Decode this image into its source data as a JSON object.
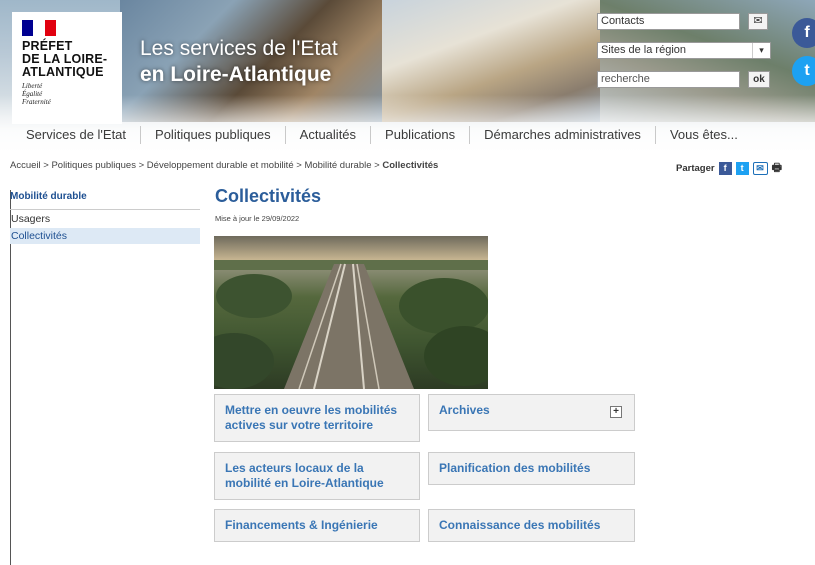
{
  "header": {
    "logo": {
      "title_lines": [
        "PRÉFET",
        "DE LA LOIRE-",
        "ATLANTIQUE"
      ],
      "motto_lines": [
        "Liberté",
        "Égalité",
        "Fraternité"
      ]
    },
    "site_title_line1": "Les services de l'Etat",
    "site_title_line2": "en Loire-Atlantique",
    "contacts_label": "Contacts",
    "sites_select_value": "Sites de la région",
    "search_placeholder": "recherche",
    "ok_label": "ok",
    "mail_icon": "✉",
    "select_caret": "▾",
    "social_fb": "f",
    "social_tw": "t",
    "nav": [
      "Services de l'Etat",
      "Politiques publiques",
      "Actualités",
      "Publications",
      "Démarches administratives",
      "Vous êtes..."
    ]
  },
  "breadcrumb": {
    "items": [
      "Accueil",
      "Politiques publiques",
      "Développement durable et mobilité",
      "Mobilité durable"
    ],
    "separator": " > ",
    "current": "Collectivités"
  },
  "share": {
    "label": "Partager",
    "fb": "f",
    "tw": "t",
    "mail": "✉",
    "print": "🖶"
  },
  "sidebar": {
    "title": "Mobilité durable",
    "items": [
      "Usagers",
      "Collectivités"
    ]
  },
  "main": {
    "title": "Collectivités",
    "updated": "Mise à jour le 29/09/2022",
    "cards": [
      "Mettre en oeuvre les mobilités actives sur votre territoire",
      "Archives",
      "Les acteurs locaux de la mobilité en Loire-Atlantique",
      "Planification des mobilités",
      "Financements & Ingénierie",
      "Connaissance des mobilités"
    ],
    "archives_expand": "+"
  },
  "colors": {
    "title_blue": "#2b5d9a",
    "link_blue": "#3a76b5",
    "sidebar_active": "#dde9f5",
    "marianne_blue": "#000091",
    "marianne_red": "#e1000f"
  }
}
